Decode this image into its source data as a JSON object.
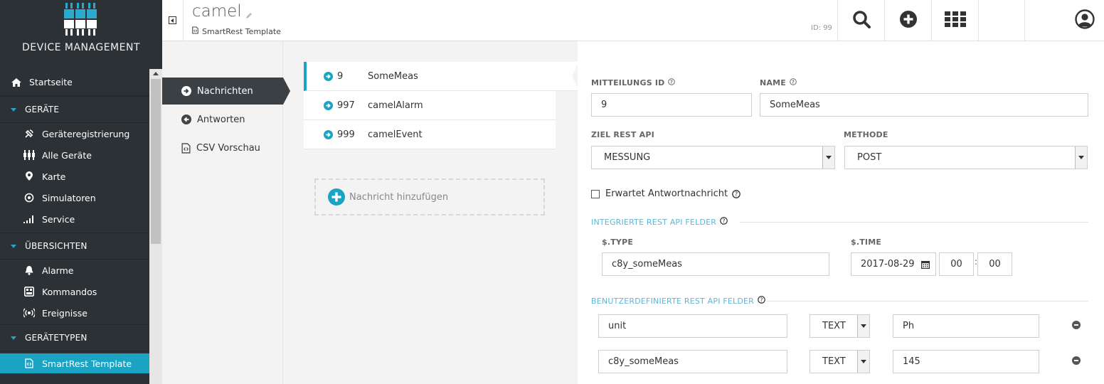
{
  "sidebar": {
    "brand_title": "DEVICE MANAGEMENT",
    "items": [
      {
        "label": "Startseite",
        "icon": "home-icon"
      },
      {
        "label": "GERÄTE",
        "group": true
      },
      {
        "label": "Geräteregistrierung",
        "icon": "satellite-icon"
      },
      {
        "label": "Alle Geräte",
        "icon": "devices-icon"
      },
      {
        "label": "Karte",
        "icon": "map-marker-icon"
      },
      {
        "label": "Simulatoren",
        "icon": "simulator-icon"
      },
      {
        "label": "Service",
        "icon": "signal-icon"
      },
      {
        "label": "ÜBERSICHTEN",
        "group": true
      },
      {
        "label": "Alarme",
        "icon": "bell-icon"
      },
      {
        "label": "Kommandos",
        "icon": "command-icon"
      },
      {
        "label": "Ereignisse",
        "icon": "broadcast-icon"
      },
      {
        "label": "GERÄTETYPEN",
        "group": true
      },
      {
        "label": "SmartRest Template",
        "icon": "template-file-icon",
        "active": true
      }
    ]
  },
  "header": {
    "title": "camel",
    "subtitle": "SmartRest Template",
    "id_label": "ID: 99"
  },
  "tabs": [
    {
      "label": "Nachrichten",
      "active": true
    },
    {
      "label": "Antworten"
    },
    {
      "label": "CSV Vorschau"
    }
  ],
  "messages": [
    {
      "id": "9",
      "name": "SomeMeas",
      "active": true
    },
    {
      "id": "997",
      "name": "camelAlarm"
    },
    {
      "id": "999",
      "name": "camelEvent"
    }
  ],
  "add_message_label": "Nachricht hinzufügen",
  "form": {
    "message_id_label": "MITTEILUNGS ID",
    "message_id_value": "9",
    "name_label": "NAME",
    "name_value": "SomeMeas",
    "target_api_label": "ZIEL REST API",
    "target_api_value": "MESSUNG",
    "method_label": "METHODE",
    "method_value": "POST",
    "expects_response_label": "Erwartet Antwortnachricht",
    "builtin_section_label": "INTEGRIERTE REST API FELDER",
    "type_label": "$.TYPE",
    "type_value": "c8y_someMeas",
    "time_label": "$.TIME",
    "time_date": "2017-08-29",
    "time_hour": "00",
    "time_minute": "00",
    "time_sep": ":",
    "custom_section_label": "BENUTZERDEFINIERTE REST API FELDER",
    "custom_fields": [
      {
        "path": "unit",
        "type": "TEXT",
        "value": "Ph"
      },
      {
        "path": "c8y_someMeas",
        "type": "TEXT",
        "value": "145"
      }
    ]
  },
  "colors": {
    "sidebar_bg": "#2c3135",
    "accent": "#1ba3c4",
    "logo": "#2aa9d1"
  }
}
